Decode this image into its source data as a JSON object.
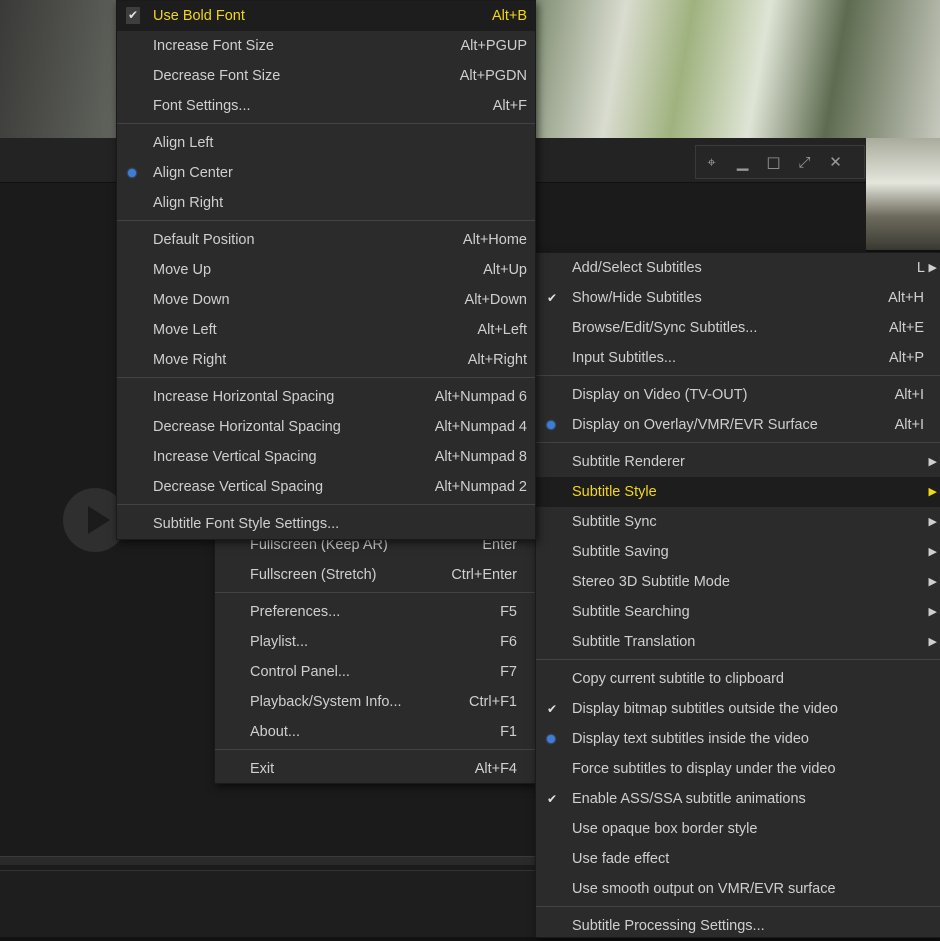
{
  "window": {
    "buttons": [
      "pin-icon",
      "minimize-icon",
      "maximize-icon",
      "fullscreen-icon",
      "close-icon"
    ]
  },
  "colors": {
    "accent": "#f2d61b",
    "radio": "#3d7dd8",
    "menu_bg": "#2b2b2b"
  },
  "main_menu": {
    "items": [
      {
        "label": "Fullscreen (Keep AR)",
        "shortcut": "Enter"
      },
      {
        "label": "Fullscreen (Stretch)",
        "shortcut": "Ctrl+Enter"
      },
      {
        "label": "Preferences...",
        "shortcut": "F5"
      },
      {
        "label": "Playlist...",
        "shortcut": "F6"
      },
      {
        "label": "Control Panel...",
        "shortcut": "F7"
      },
      {
        "label": "Playback/System Info...",
        "shortcut": "Ctrl+F1"
      },
      {
        "label": "About...",
        "shortcut": "F1"
      },
      {
        "label": "Exit",
        "shortcut": "Alt+F4"
      }
    ]
  },
  "font_menu": {
    "items": [
      {
        "label": "Use Bold Font",
        "shortcut": "Alt+B",
        "checked": true,
        "highlighted": true
      },
      {
        "label": "Increase Font Size",
        "shortcut": "Alt+PGUP"
      },
      {
        "label": "Decrease Font Size",
        "shortcut": "Alt+PGDN"
      },
      {
        "label": "Font Settings...",
        "shortcut": "Alt+F"
      },
      {
        "label": "Align Left",
        "shortcut": ""
      },
      {
        "label": "Align Center",
        "shortcut": "",
        "selected": true
      },
      {
        "label": "Align Right",
        "shortcut": ""
      },
      {
        "label": "Default Position",
        "shortcut": "Alt+Home"
      },
      {
        "label": "Move Up",
        "shortcut": "Alt+Up"
      },
      {
        "label": "Move Down",
        "shortcut": "Alt+Down"
      },
      {
        "label": "Move Left",
        "shortcut": "Alt+Left"
      },
      {
        "label": "Move Right",
        "shortcut": "Alt+Right"
      },
      {
        "label": "Increase Horizontal Spacing",
        "shortcut": "Alt+Numpad 6"
      },
      {
        "label": "Decrease Horizontal Spacing",
        "shortcut": "Alt+Numpad 4"
      },
      {
        "label": "Increase Vertical Spacing",
        "shortcut": "Alt+Numpad 8"
      },
      {
        "label": "Decrease Vertical Spacing",
        "shortcut": "Alt+Numpad 2"
      },
      {
        "label": "Subtitle Font Style Settings...",
        "shortcut": ""
      }
    ]
  },
  "subtitle_menu": {
    "items": [
      {
        "label": "Add/Select Subtitles",
        "shortcut": "L"
      },
      {
        "label": "Show/Hide Subtitles",
        "shortcut": "Alt+H",
        "checked": true
      },
      {
        "label": "Browse/Edit/Sync Subtitles...",
        "shortcut": "Alt+E"
      },
      {
        "label": "Input Subtitles...",
        "shortcut": "Alt+P"
      },
      {
        "label": "Display on Video (TV-OUT)",
        "shortcut": "Alt+I"
      },
      {
        "label": "Display on Overlay/VMR/EVR Surface",
        "shortcut": "Alt+I",
        "selected": true
      },
      {
        "label": "Subtitle Renderer",
        "shortcut": ""
      },
      {
        "label": "Subtitle Style",
        "shortcut": "",
        "highlighted": true
      },
      {
        "label": "Subtitle Sync",
        "shortcut": ""
      },
      {
        "label": "Subtitle Saving",
        "shortcut": ""
      },
      {
        "label": "Stereo 3D Subtitle Mode",
        "shortcut": ""
      },
      {
        "label": "Subtitle Searching",
        "shortcut": ""
      },
      {
        "label": "Subtitle Translation",
        "shortcut": ""
      },
      {
        "label": "Copy current subtitle to clipboard",
        "shortcut": ""
      },
      {
        "label": "Display bitmap subtitles outside the video",
        "shortcut": "",
        "checked": true
      },
      {
        "label": "Display text subtitles inside the video",
        "shortcut": "",
        "selected": true
      },
      {
        "label": "Force subtitles to display under the video",
        "shortcut": ""
      },
      {
        "label": "Enable ASS/SSA subtitle animations",
        "shortcut": "",
        "checked": true
      },
      {
        "label": "Use opaque box border style",
        "shortcut": ""
      },
      {
        "label": "Use fade effect",
        "shortcut": ""
      },
      {
        "label": "Use smooth output on VMR/EVR surface",
        "shortcut": ""
      },
      {
        "label": "Subtitle Processing Settings...",
        "shortcut": ""
      }
    ]
  }
}
